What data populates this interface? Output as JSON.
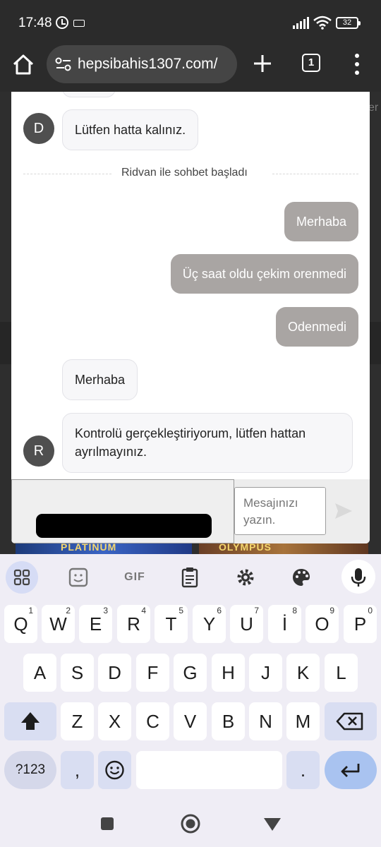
{
  "status_bar": {
    "time": "17:48",
    "battery": "32"
  },
  "browser": {
    "url": "hepsibahis1307.com/",
    "tab_count": "1"
  },
  "page_background": {
    "edge_text": "er",
    "game_left": "PLATINUM",
    "game_right": "OLYMPUS"
  },
  "chat": {
    "messages": [
      {
        "sender": "D",
        "text": "Lütfen hatta kalınız."
      },
      {
        "system": "Ridvan ile sohbet başladı"
      },
      {
        "outgoing": "Merhaba"
      },
      {
        "outgoing": "Üç saat oldu çekim orenmedi"
      },
      {
        "outgoing": "Odenmedi"
      },
      {
        "incoming": "Merhaba"
      },
      {
        "sender": "R",
        "text": "Kontrolü gerçekleştiriyorum, lütfen hattan ayrılmayınız."
      }
    ],
    "input_placeholder": "Mesajınızı yazın."
  },
  "keyboard": {
    "toolbar": [
      "apps-icon",
      "sticker-icon",
      "GIF",
      "clipboard-icon",
      "gear-icon",
      "palette-icon",
      "mic-icon"
    ],
    "row1": [
      {
        "k": "Q",
        "n": "1"
      },
      {
        "k": "W",
        "n": "2"
      },
      {
        "k": "E",
        "n": "3"
      },
      {
        "k": "R",
        "n": "4"
      },
      {
        "k": "T",
        "n": "5"
      },
      {
        "k": "Y",
        "n": "6"
      },
      {
        "k": "U",
        "n": "7"
      },
      {
        "k": "İ",
        "n": "8"
      },
      {
        "k": "O",
        "n": "9"
      },
      {
        "k": "P",
        "n": "0"
      }
    ],
    "row2": [
      "A",
      "S",
      "D",
      "F",
      "G",
      "H",
      "J",
      "K",
      "L"
    ],
    "row3": [
      "Z",
      "X",
      "C",
      "V",
      "B",
      "N",
      "M"
    ],
    "symbols_key": "?123",
    "comma_key": ",",
    "period_key": "."
  }
}
